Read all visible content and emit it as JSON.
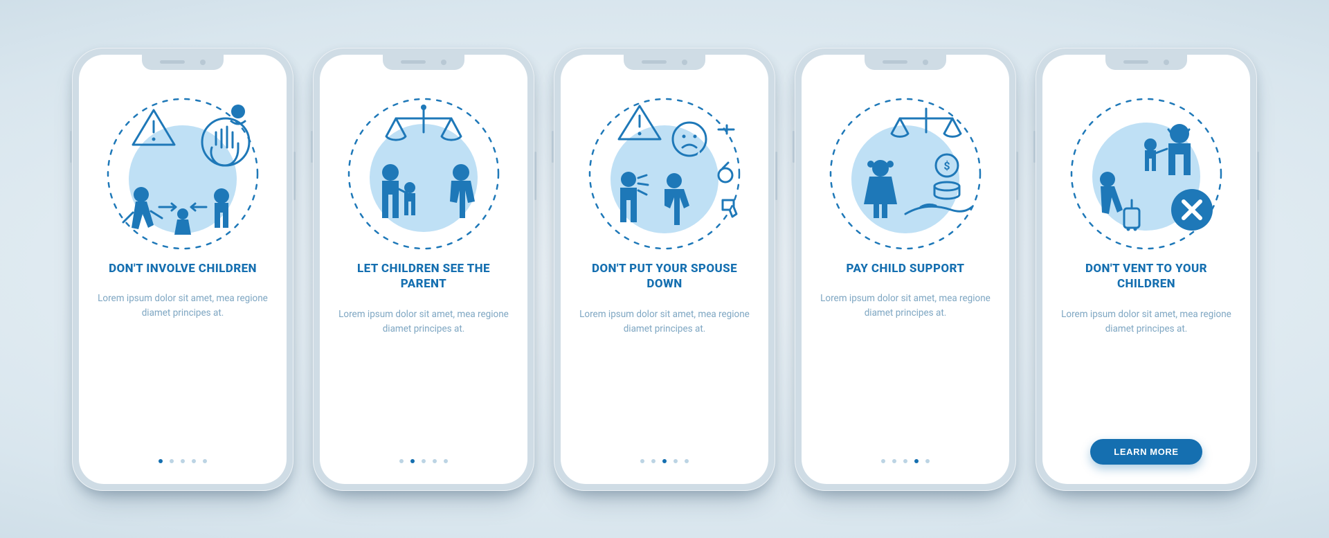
{
  "colors": {
    "accent": "#156fb0",
    "muted_text": "#7ea6c2",
    "dot_inactive": "#bcd4e4"
  },
  "common": {
    "body": "Lorem ipsum dolor sit amet, mea regione diamet principes at.",
    "cta_label": "LEARN MORE",
    "page_count": 5
  },
  "screens": [
    {
      "index": 0,
      "title": "DON'T INVOLVE CHILDREN",
      "icon": "involve-children",
      "has_cta": false
    },
    {
      "index": 1,
      "title": "LET CHILDREN SEE THE PARENT",
      "icon": "see-parent",
      "has_cta": false
    },
    {
      "index": 2,
      "title": "DON'T PUT YOUR SPOUSE DOWN",
      "icon": "spouse-down",
      "has_cta": false
    },
    {
      "index": 3,
      "title": "PAY CHILD SUPPORT",
      "icon": "child-support",
      "has_cta": false
    },
    {
      "index": 4,
      "title": "DON'T VENT TO YOUR CHILDREN",
      "icon": "dont-vent",
      "has_cta": true
    }
  ]
}
